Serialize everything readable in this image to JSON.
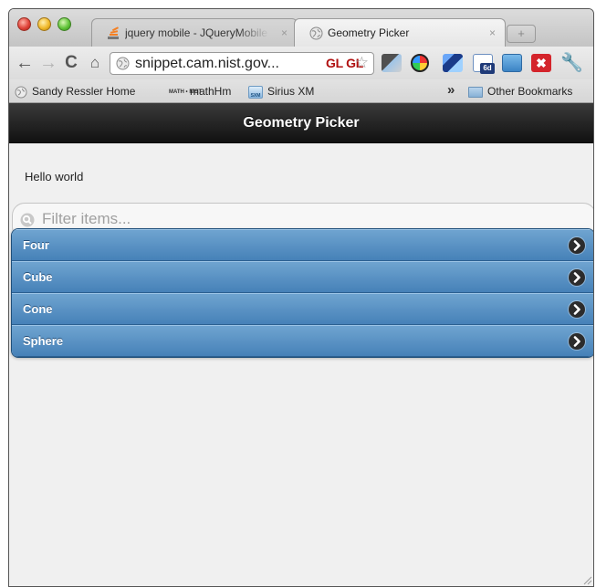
{
  "browser": {
    "tabs": [
      {
        "title": "jquery mobile - JQueryMobile",
        "close": "×"
      },
      {
        "title": "Geometry Picker",
        "close": "×"
      }
    ],
    "new_tab": "+",
    "toolbar": {
      "back": "←",
      "forward": "→",
      "reload": "C",
      "home": "⌂",
      "url": "snippet.cam.nist.gov...",
      "gl_badge": "GL GL",
      "star": "☆",
      "wrench": "🔧",
      "badge_6d": "6d",
      "ext_red_letter": "✖"
    },
    "bookmarks": [
      {
        "label": "Sandy Ressler Home",
        "icon": "globe-icon"
      },
      {
        "label": "mathHm",
        "icon": "math-nist-icon",
        "icon_text": "MATH • NIST"
      },
      {
        "label": "Sirius XM",
        "icon": "sirius-icon",
        "icon_text": "SXM"
      }
    ],
    "overflow": "»",
    "other_bookmarks": "Other Bookmarks"
  },
  "app": {
    "header_title": "Geometry Picker",
    "intro_text": "Hello world",
    "filter_placeholder": "Filter items...",
    "items": [
      "Four",
      "Cube",
      "Cone",
      "Sphere"
    ]
  },
  "colors": {
    "list_top": "#6fa4d0",
    "list_bottom": "#4681b8",
    "header_top": "#3a3a3a",
    "header_bottom": "#111111"
  }
}
